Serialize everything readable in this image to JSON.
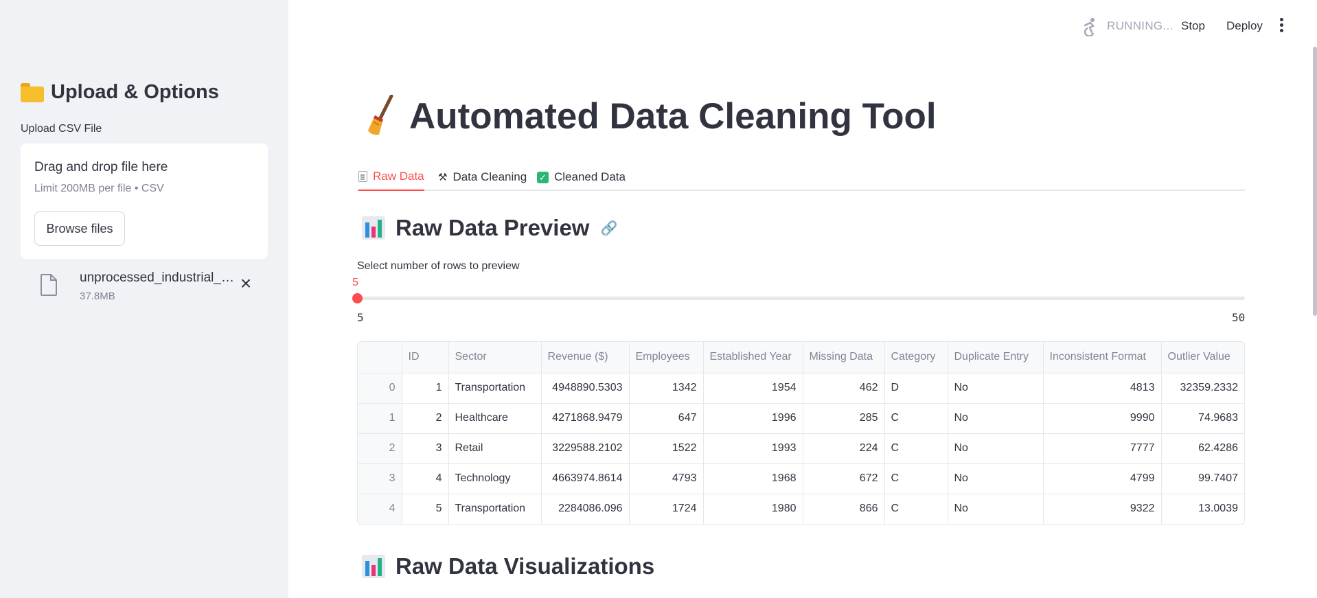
{
  "sidebar": {
    "title": "Upload & Options",
    "upload_label": "Upload CSV File",
    "dropzone_title": "Drag and drop file here",
    "dropzone_limit": "Limit 200MB per file • CSV",
    "browse_label": "Browse files",
    "file": {
      "name": "unprocessed_industrial_data.csv",
      "size": "37.8MB"
    }
  },
  "header": {
    "status": "RUNNING...",
    "stop_label": "Stop",
    "deploy_label": "Deploy"
  },
  "main": {
    "title": "Automated Data Cleaning Tool",
    "tabs": [
      {
        "label": "Raw Data",
        "icon": "document-icon",
        "active": true
      },
      {
        "label": "Data Cleaning",
        "icon": "tools-icon",
        "active": false
      },
      {
        "label": "Cleaned Data",
        "icon": "check-icon",
        "active": false
      }
    ],
    "preview_heading": "Raw Data Preview",
    "slider": {
      "label": "Select number of rows to preview",
      "value": "5",
      "min": "5",
      "max": "50"
    },
    "viz_heading": "Raw Data Visualizations"
  },
  "table": {
    "columns": [
      "",
      "ID",
      "Sector",
      "Revenue ($)",
      "Employees",
      "Established Year",
      "Missing Data",
      "Category",
      "Duplicate Entry",
      "Inconsistent Format",
      "Outlier Value"
    ],
    "rows": [
      [
        "0",
        "1",
        "Transportation",
        "4948890.5303",
        "1342",
        "1954",
        "462",
        "D",
        "No",
        "4813",
        "32359.2332"
      ],
      [
        "1",
        "2",
        "Healthcare",
        "4271868.9479",
        "647",
        "1996",
        "285",
        "C",
        "No",
        "9990",
        "74.9683"
      ],
      [
        "2",
        "3",
        "Retail",
        "3229588.2102",
        "1522",
        "1993",
        "224",
        "C",
        "No",
        "7777",
        "62.4286"
      ],
      [
        "3",
        "4",
        "Technology",
        "4663974.8614",
        "4793",
        "1968",
        "672",
        "C",
        "No",
        "4799",
        "99.7407"
      ],
      [
        "4",
        "5",
        "Transportation",
        "2284086.096",
        "1724",
        "1980",
        "866",
        "C",
        "No",
        "9322",
        "13.0039"
      ]
    ]
  },
  "colors": {
    "accent": "#ff4b4b",
    "sidebar_bg": "#f0f2f6",
    "text": "#31333f",
    "muted": "#808495"
  }
}
